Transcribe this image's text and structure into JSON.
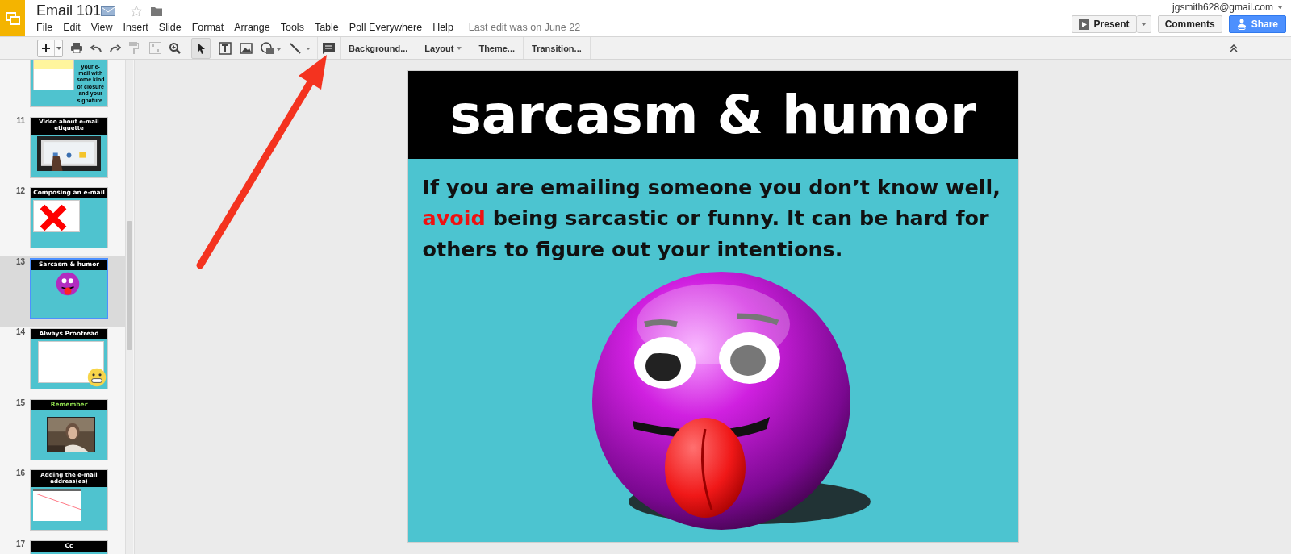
{
  "header": {
    "document_title": "Email 101",
    "starred": false,
    "menu": [
      "File",
      "Edit",
      "View",
      "Insert",
      "Slide",
      "Format",
      "Arrange",
      "Tools",
      "Table",
      "Poll Everywhere",
      "Help"
    ],
    "last_edit": "Last edit was on June 22",
    "account": "jgsmith628@gmail.com",
    "present": "Present",
    "comments": "Comments",
    "share": "Share"
  },
  "toolbar": {
    "buttons": [
      {
        "label": "Background...",
        "dropdown": false
      },
      {
        "label": "Layout",
        "dropdown": true
      },
      {
        "label": "Theme...",
        "dropdown": false
      },
      {
        "label": "Transition...",
        "dropdown": false
      }
    ]
  },
  "slides": [
    {
      "kind": "closure",
      "selected": false,
      "side_text": "your e-mail with some kind of closure and your signature."
    },
    {
      "number": "11",
      "kind": "video",
      "title": "Video about e-mail etiquette",
      "selected": false
    },
    {
      "number": "12",
      "kind": "composing",
      "title": "Composing an e-mail",
      "selected": false
    },
    {
      "number": "13",
      "kind": "humor",
      "title": "Sarcasm & humor",
      "selected": true
    },
    {
      "number": "14",
      "kind": "proofread",
      "title": "Always Proofread",
      "selected": false
    },
    {
      "number": "15",
      "kind": "remember",
      "title": "Remember",
      "selected": false
    },
    {
      "number": "16",
      "kind": "address",
      "title": "Adding the e-mail address(es)",
      "selected": false
    },
    {
      "number": "17",
      "kind": "cc",
      "title": "Cc",
      "selected": false
    }
  ],
  "current_slide": {
    "title": "sarcasm & humor",
    "paragraph": [
      {
        "kind": "plain",
        "text": "If you are emailing someone you don’t know well, "
      },
      {
        "kind": "warning",
        "text": "avoid"
      },
      {
        "kind": "plain",
        "text": " being sarcastic or funny. It can be hard for others to figure out your intentions."
      }
    ]
  }
}
